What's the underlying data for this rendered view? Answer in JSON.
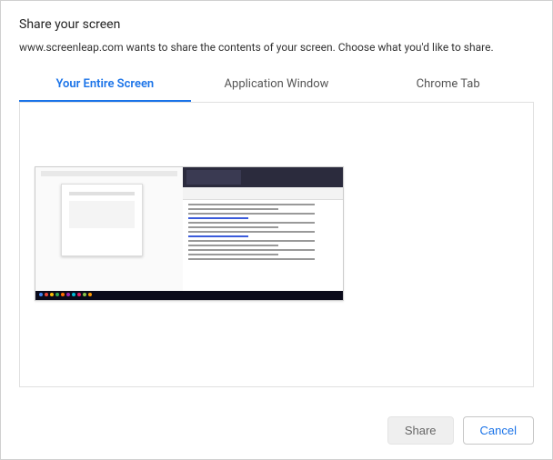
{
  "title": "Share your screen",
  "subtitle": "www.screenleap.com wants to share the contents of your screen. Choose what you'd like to share.",
  "tabs": [
    {
      "label": "Your Entire Screen",
      "active": true
    },
    {
      "label": "Application Window",
      "active": false
    },
    {
      "label": "Chrome Tab",
      "active": false
    }
  ],
  "buttons": {
    "share": "Share",
    "cancel": "Cancel"
  }
}
